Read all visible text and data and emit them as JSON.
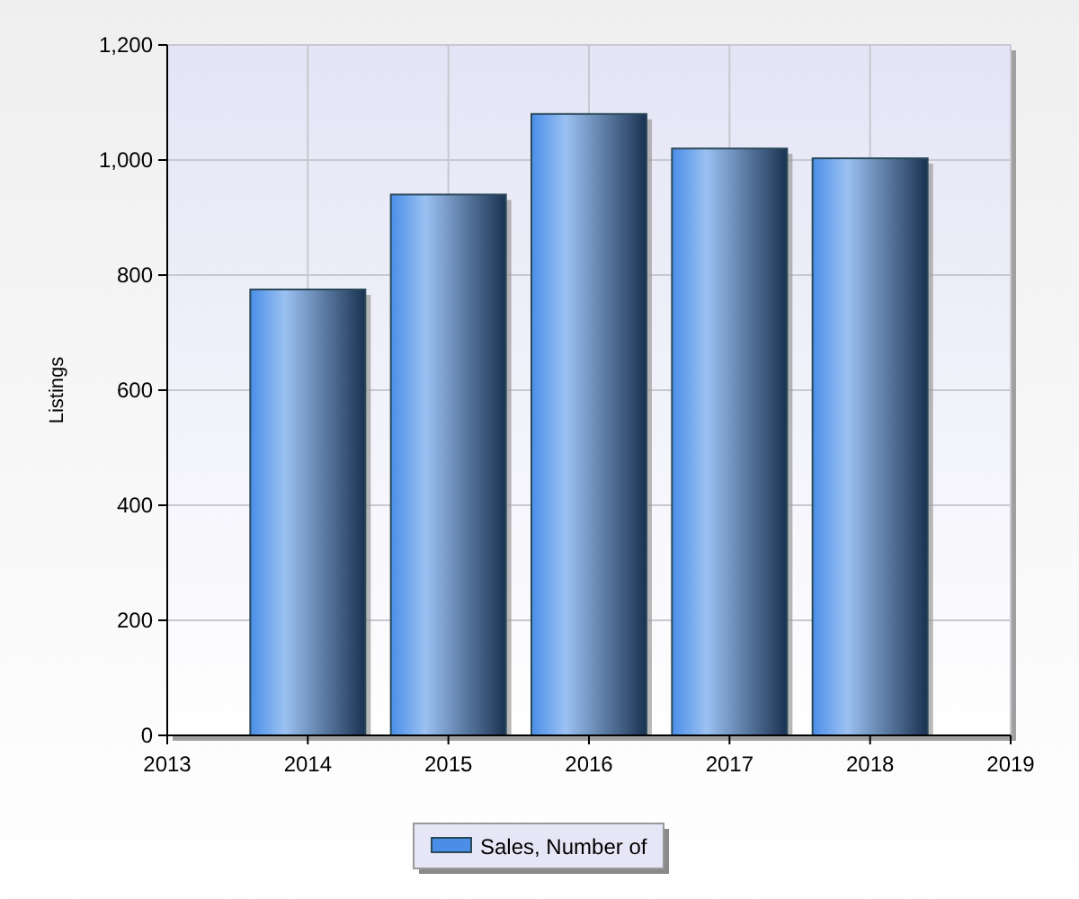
{
  "chart_data": {
    "type": "bar",
    "grid": true,
    "ylabel": "Listings",
    "x": [
      2014,
      2015,
      2016,
      2017,
      2018
    ],
    "series": [
      {
        "name": "Sales, Number of",
        "color": "#4a8ee8",
        "values": [
          775,
          940,
          1080,
          1020,
          1003
        ]
      }
    ],
    "xlim": [
      2013,
      2019
    ],
    "ylim": [
      0,
      1200
    ],
    "xticks": [
      2013,
      2014,
      2015,
      2016,
      2017,
      2018,
      2019
    ],
    "yticks": [
      {
        "value": 0,
        "label": "0"
      },
      {
        "value": 200,
        "label": "200"
      },
      {
        "value": 400,
        "label": "400"
      },
      {
        "value": 600,
        "label": "600"
      },
      {
        "value": 800,
        "label": "800"
      },
      {
        "value": 1000,
        "label": "1,000"
      },
      {
        "value": 1200,
        "label": "1,200"
      }
    ]
  }
}
